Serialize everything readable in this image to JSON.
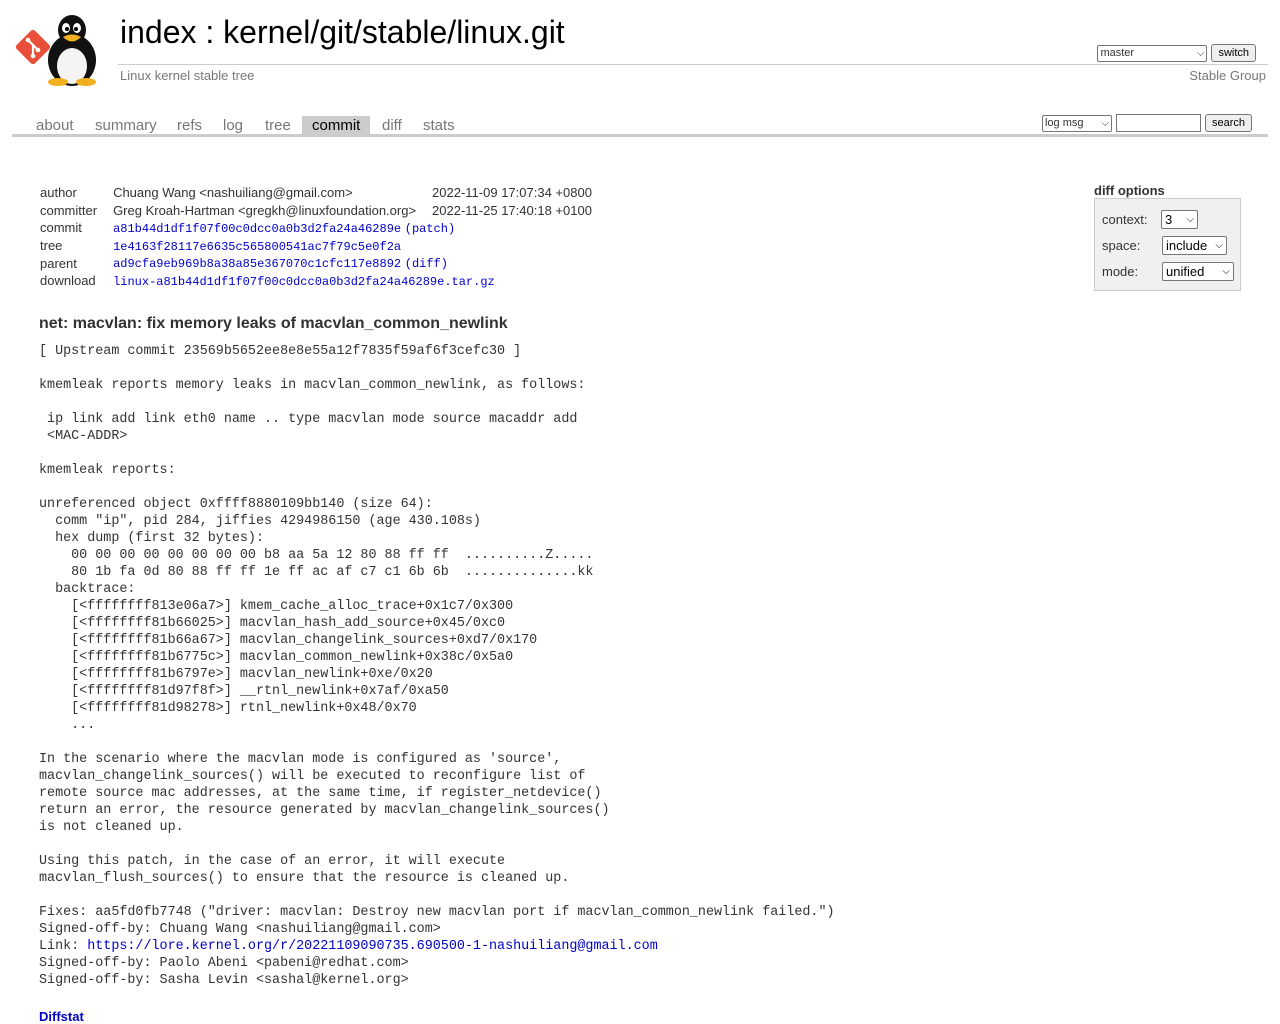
{
  "header": {
    "title_index": "index",
    "title_sep": " : ",
    "title_repo": "kernel/git/stable/linux.git",
    "description": "Linux kernel stable tree",
    "owner": "Stable Group",
    "branch_selected": "master",
    "switch_label": "switch"
  },
  "tabs": [
    {
      "label": "about"
    },
    {
      "label": "summary"
    },
    {
      "label": "refs"
    },
    {
      "label": "log"
    },
    {
      "label": "tree"
    },
    {
      "label": "commit"
    },
    {
      "label": "diff"
    },
    {
      "label": "stats"
    }
  ],
  "search": {
    "scope_selected": "log msg",
    "button_label": "search",
    "query": ""
  },
  "commit_info": {
    "author_label": "author",
    "author": "Chuang Wang <nashuiliang@gmail.com>",
    "author_date": "2022-11-09 17:07:34 +0800",
    "committer_label": "committer",
    "committer": "Greg Kroah-Hartman <gregkh@linuxfoundation.org>",
    "committer_date": "2022-11-25 17:40:18 +0100",
    "commit_label": "commit",
    "commit_sha": "a81b44d1df1f07f00c0dcc0a0b3d2fa24a46289e",
    "patch_label": "patch",
    "tree_label": "tree",
    "tree_sha": "1e4163f28117e6635c565800541ac7f79c5e0f2a",
    "parent_label": "parent",
    "parent_sha": "ad9cfa9eb969b8a38a85e367070c1cfc117e8892",
    "diff_label": "diff",
    "download_label": "download",
    "download_file": "linux-a81b44d1df1f07f00c0dcc0a0b3d2fa24a46289e.tar.gz"
  },
  "diff_options": {
    "title": "diff options",
    "context_label": "context:",
    "context_value": "3",
    "space_label": "space:",
    "space_value": "include",
    "mode_label": "mode:",
    "mode_value": "unified"
  },
  "commit": {
    "subject": "net: macvlan: fix memory leaks of macvlan_common_newlink",
    "body_before_link": "[ Upstream commit 23569b5652ee8e8e55a12f7835f59af6f3cefc30 ]\n\nkmemleak reports memory leaks in macvlan_common_newlink, as follows:\n\n ip link add link eth0 name .. type macvlan mode source macaddr add\n <MAC-ADDR>\n\nkmemleak reports:\n\nunreferenced object 0xffff8880109bb140 (size 64):\n  comm \"ip\", pid 284, jiffies 4294986150 (age 430.108s)\n  hex dump (first 32 bytes):\n    00 00 00 00 00 00 00 00 b8 aa 5a 12 80 88 ff ff  ..........Z.....\n    80 1b fa 0d 80 88 ff ff 1e ff ac af c7 c1 6b 6b  ..............kk\n  backtrace:\n    [<ffffffff813e06a7>] kmem_cache_alloc_trace+0x1c7/0x300\n    [<ffffffff81b66025>] macvlan_hash_add_source+0x45/0xc0\n    [<ffffffff81b66a67>] macvlan_changelink_sources+0xd7/0x170\n    [<ffffffff81b6775c>] macvlan_common_newlink+0x38c/0x5a0\n    [<ffffffff81b6797e>] macvlan_newlink+0xe/0x20\n    [<ffffffff81d97f8f>] __rtnl_newlink+0x7af/0xa50\n    [<ffffffff81d98278>] rtnl_newlink+0x48/0x70\n    ...\n\nIn the scenario where the macvlan mode is configured as 'source',\nmacvlan_changelink_sources() will be executed to reconfigure list of\nremote source mac addresses, at the same time, if register_netdevice()\nreturn an error, the resource generated by macvlan_changelink_sources()\nis not cleaned up.\n\nUsing this patch, in the case of an error, it will execute\nmacvlan_flush_sources() to ensure that the resource is cleaned up.\n\nFixes: aa5fd0fb7748 (\"driver: macvlan: Destroy new macvlan port if macvlan_common_newlink failed.\")\nSigned-off-by: Chuang Wang <nashuiliang@gmail.com>\nLink: ",
    "link_url": "https://lore.kernel.org/r/20221109090735.690500-1-nashuiliang@gmail.com",
    "body_after_link": "\nSigned-off-by: Paolo Abeni <pabeni@redhat.com>\nSigned-off-by: Sasha Levin <sashal@kernel.org>"
  },
  "diffstat_label": "Diffstat",
  "colors": {
    "link": "#0000cc",
    "tab_active_bg": "#cccccc",
    "muted_text": "#777777"
  },
  "icons": {
    "logo": "git-logo",
    "mascot": "tux-penguin-icon"
  }
}
